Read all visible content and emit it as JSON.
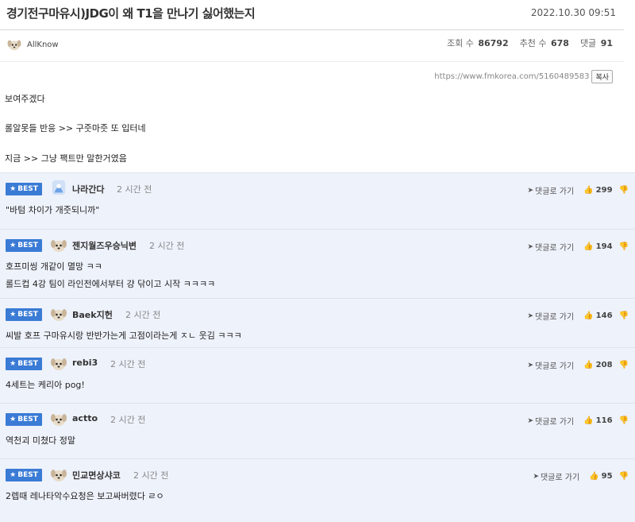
{
  "post": {
    "title": "경기전구마유시)JDG이 왜 T1을 만나기 싫어했는지",
    "date": "2022.10.30 09:51",
    "author": "AllKnow",
    "stats": {
      "views_label": "조회 수",
      "views": "86792",
      "recommend_label": "추천 수",
      "recommend": "678",
      "comments_label": "댓글",
      "comments": "91"
    },
    "url": "https://www.fmkorea.com/5160489583",
    "copy_label": "복사",
    "body": [
      "보여주겠다",
      "롤알못들 반응 >> 구줏마줏 또 입터네",
      "지금 >> 그냥 팩트만 말한거였음"
    ]
  },
  "comments": [
    {
      "badge": "BEST",
      "author": "나라간다",
      "time": "2 시간 전",
      "reply": "댓글로 가기",
      "likes": "299",
      "lines": [
        "\"바텀 차이가 개줏되니까\""
      ],
      "avatar": "blue-character-icon"
    },
    {
      "badge": "BEST",
      "author": "젠지월즈우승닉변",
      "time": "2 시간 전",
      "reply": "댓글로 가기",
      "likes": "194",
      "lines": [
        "호프미씽 개같이 멸망 ㅋㅋ",
        "롤드컵 4강 팀이 라인전에서부터 걍 닦이고 시작 ㅋㅋㅋㅋ"
      ],
      "avatar": "puppy-icon"
    },
    {
      "badge": "BEST",
      "author": "Baek지헌",
      "time": "2 시간 전",
      "reply": "댓글로 가기",
      "likes": "146",
      "lines": [
        "씨발 호프 구마유시랑 반반가는게 고점이라는게 ㅈㄴ 웃김 ㅋㅋㅋ"
      ],
      "avatar": "puppy-icon"
    },
    {
      "badge": "BEST",
      "author": "rebi3",
      "time": "2 시간 전",
      "reply": "댓글로 가기",
      "likes": "208",
      "lines": [
        "4세트는 케리아 pog!"
      ],
      "avatar": "puppy-icon"
    },
    {
      "badge": "BEST",
      "author": "actto",
      "time": "2 시간 전",
      "reply": "댓글로 가기",
      "likes": "116",
      "lines": [
        "역천괴 미쳤다 정말"
      ],
      "avatar": "puppy-icon"
    },
    {
      "badge": "BEST",
      "author": "민교면상샤코",
      "time": "2 시간 전",
      "reply": "댓글로 가기",
      "likes": "95",
      "lines": [
        "2렙때 레나타악수요청은 보고싸버렸다 ㄹㅇ"
      ],
      "avatar": "puppy-icon"
    }
  ],
  "colors": {
    "badge": "#3a7bd5",
    "comment_bg": "#eef2fb"
  }
}
